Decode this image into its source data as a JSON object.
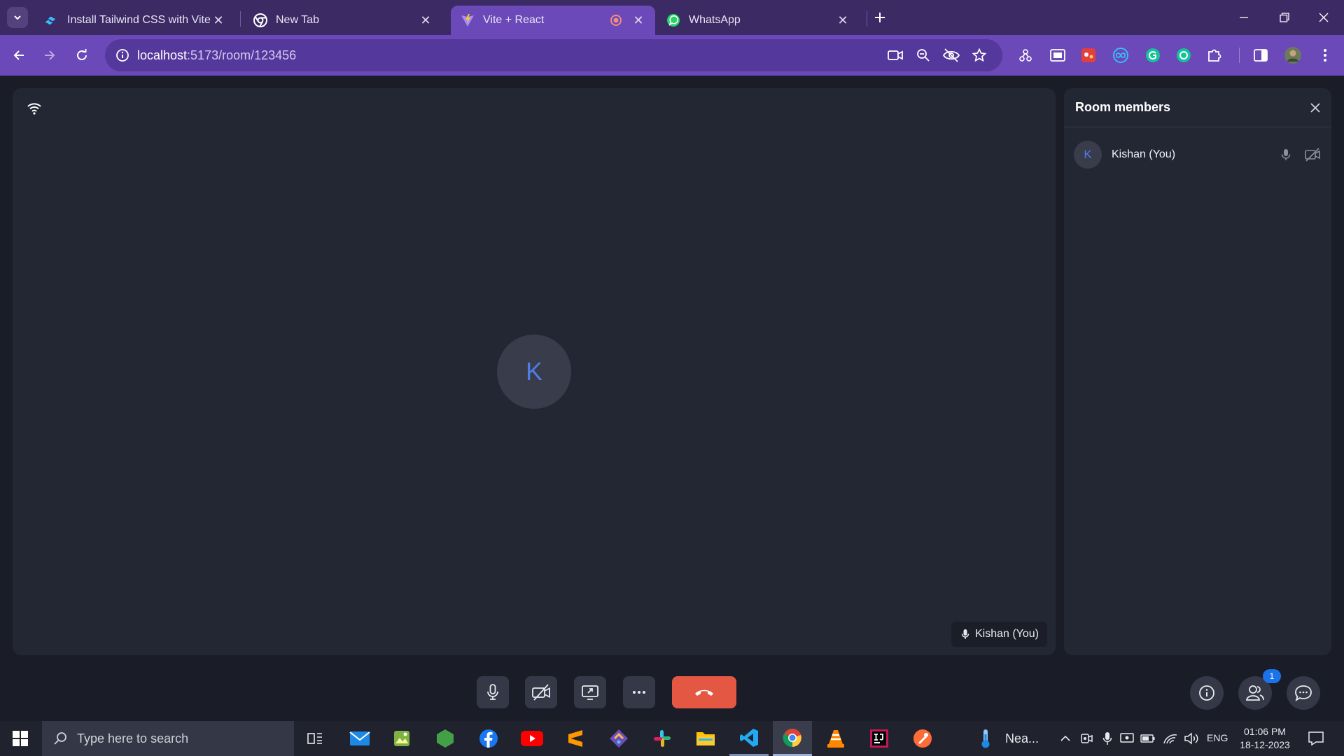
{
  "browser": {
    "tabs": [
      {
        "title": "Install Tailwind CSS with Vite - Tailwind CSS",
        "favicon": "tailwind-icon",
        "active": false
      },
      {
        "title": "New Tab",
        "favicon": "chrome-icon",
        "active": false
      },
      {
        "title": "Vite + React",
        "favicon": "vite-icon",
        "active": true,
        "recording": true
      },
      {
        "title": "WhatsApp",
        "favicon": "whatsapp-icon",
        "active": false
      }
    ],
    "url_host": "localhost",
    "url_path": ":5173/room/123456"
  },
  "room": {
    "participant_initial": "K",
    "participant_label": "Kishan (You)",
    "members_title": "Room members",
    "members": [
      {
        "initial": "K",
        "name": "Kishan (You)"
      }
    ],
    "participants_badge": "1"
  },
  "taskbar": {
    "search_placeholder": "Type here to search",
    "weather_text": "Nea...",
    "language": "ENG",
    "time": "01:06 PM",
    "date": "18-12-2023"
  },
  "colors": {
    "tab_strip": "#3b2a63",
    "toolbar": "#6b49b8",
    "app_background": "#1a1d28",
    "panel": "#232734",
    "end_call": "#e45743",
    "avatar_letter": "#4f7de4",
    "badge": "#1a73e8"
  }
}
